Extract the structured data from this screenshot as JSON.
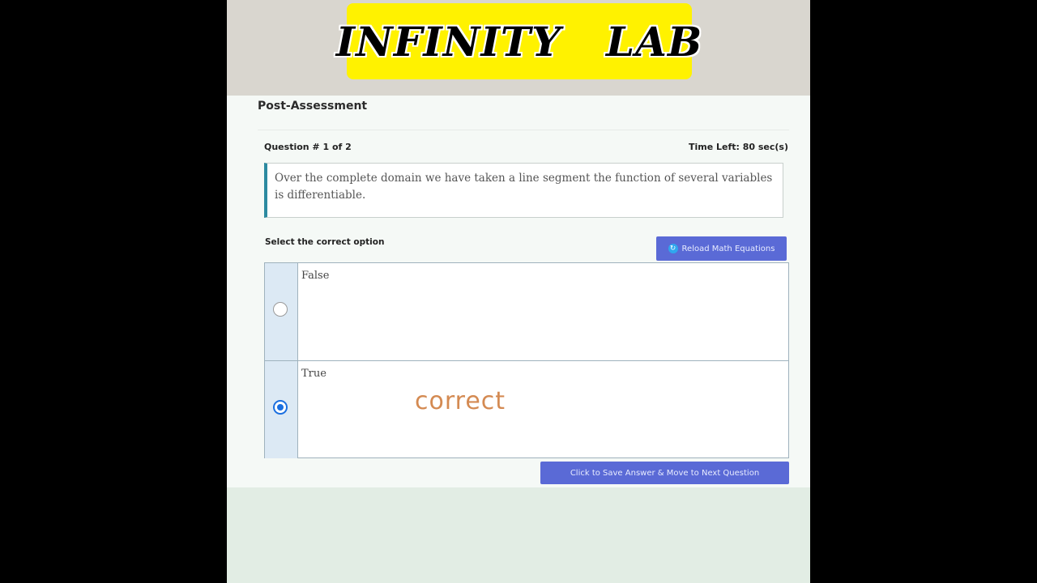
{
  "brand": {
    "text": "INFINITY   LAB"
  },
  "page": {
    "title": "Post-Assessment"
  },
  "question": {
    "number_label": "Question # 1 of 2",
    "time_left": "Time Left: 80 sec(s)",
    "text": "Over the complete domain we have taken a line segment the function of several variables is differentiable."
  },
  "select_label": "Select the correct option",
  "reload_button": {
    "label": "Reload Math Equations",
    "icon": "refresh-icon"
  },
  "options": [
    {
      "label": "False",
      "selected": false
    },
    {
      "label": "True",
      "selected": true
    }
  ],
  "overlay_note": "correct",
  "save_button": {
    "label": "Click to Save Answer & Move to Next Question"
  },
  "colors": {
    "banner": "#fff200",
    "button": "#5a6ad6",
    "radio_selected": "#1a6fe0",
    "overlay_text": "#d48a52"
  }
}
